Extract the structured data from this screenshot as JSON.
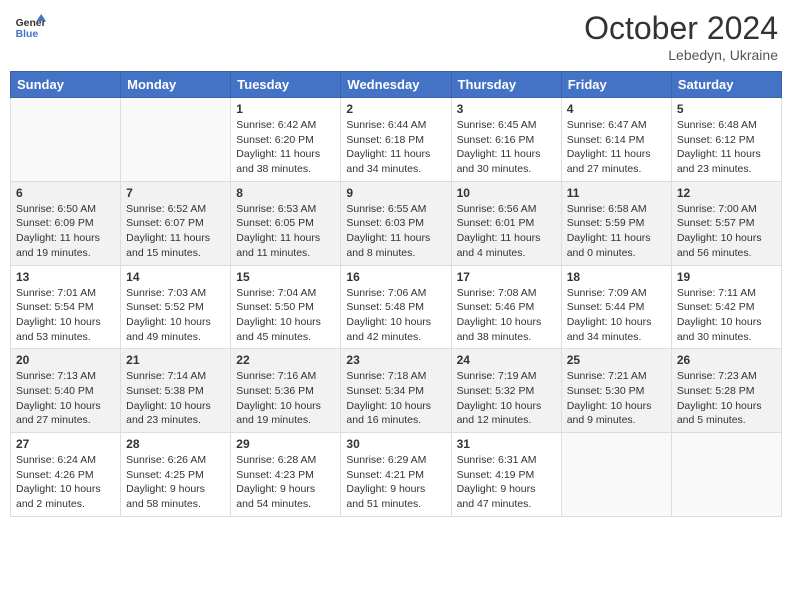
{
  "header": {
    "logo_line1": "General",
    "logo_line2": "Blue",
    "month": "October 2024",
    "location": "Lebedyn, Ukraine"
  },
  "weekdays": [
    "Sunday",
    "Monday",
    "Tuesday",
    "Wednesday",
    "Thursday",
    "Friday",
    "Saturday"
  ],
  "weeks": [
    [
      {
        "day": "",
        "info": ""
      },
      {
        "day": "",
        "info": ""
      },
      {
        "day": "1",
        "info": "Sunrise: 6:42 AM\nSunset: 6:20 PM\nDaylight: 11 hours and 38 minutes."
      },
      {
        "day": "2",
        "info": "Sunrise: 6:44 AM\nSunset: 6:18 PM\nDaylight: 11 hours and 34 minutes."
      },
      {
        "day": "3",
        "info": "Sunrise: 6:45 AM\nSunset: 6:16 PM\nDaylight: 11 hours and 30 minutes."
      },
      {
        "day": "4",
        "info": "Sunrise: 6:47 AM\nSunset: 6:14 PM\nDaylight: 11 hours and 27 minutes."
      },
      {
        "day": "5",
        "info": "Sunrise: 6:48 AM\nSunset: 6:12 PM\nDaylight: 11 hours and 23 minutes."
      }
    ],
    [
      {
        "day": "6",
        "info": "Sunrise: 6:50 AM\nSunset: 6:09 PM\nDaylight: 11 hours and 19 minutes."
      },
      {
        "day": "7",
        "info": "Sunrise: 6:52 AM\nSunset: 6:07 PM\nDaylight: 11 hours and 15 minutes."
      },
      {
        "day": "8",
        "info": "Sunrise: 6:53 AM\nSunset: 6:05 PM\nDaylight: 11 hours and 11 minutes."
      },
      {
        "day": "9",
        "info": "Sunrise: 6:55 AM\nSunset: 6:03 PM\nDaylight: 11 hours and 8 minutes."
      },
      {
        "day": "10",
        "info": "Sunrise: 6:56 AM\nSunset: 6:01 PM\nDaylight: 11 hours and 4 minutes."
      },
      {
        "day": "11",
        "info": "Sunrise: 6:58 AM\nSunset: 5:59 PM\nDaylight: 11 hours and 0 minutes."
      },
      {
        "day": "12",
        "info": "Sunrise: 7:00 AM\nSunset: 5:57 PM\nDaylight: 10 hours and 56 minutes."
      }
    ],
    [
      {
        "day": "13",
        "info": "Sunrise: 7:01 AM\nSunset: 5:54 PM\nDaylight: 10 hours and 53 minutes."
      },
      {
        "day": "14",
        "info": "Sunrise: 7:03 AM\nSunset: 5:52 PM\nDaylight: 10 hours and 49 minutes."
      },
      {
        "day": "15",
        "info": "Sunrise: 7:04 AM\nSunset: 5:50 PM\nDaylight: 10 hours and 45 minutes."
      },
      {
        "day": "16",
        "info": "Sunrise: 7:06 AM\nSunset: 5:48 PM\nDaylight: 10 hours and 42 minutes."
      },
      {
        "day": "17",
        "info": "Sunrise: 7:08 AM\nSunset: 5:46 PM\nDaylight: 10 hours and 38 minutes."
      },
      {
        "day": "18",
        "info": "Sunrise: 7:09 AM\nSunset: 5:44 PM\nDaylight: 10 hours and 34 minutes."
      },
      {
        "day": "19",
        "info": "Sunrise: 7:11 AM\nSunset: 5:42 PM\nDaylight: 10 hours and 30 minutes."
      }
    ],
    [
      {
        "day": "20",
        "info": "Sunrise: 7:13 AM\nSunset: 5:40 PM\nDaylight: 10 hours and 27 minutes."
      },
      {
        "day": "21",
        "info": "Sunrise: 7:14 AM\nSunset: 5:38 PM\nDaylight: 10 hours and 23 minutes."
      },
      {
        "day": "22",
        "info": "Sunrise: 7:16 AM\nSunset: 5:36 PM\nDaylight: 10 hours and 19 minutes."
      },
      {
        "day": "23",
        "info": "Sunrise: 7:18 AM\nSunset: 5:34 PM\nDaylight: 10 hours and 16 minutes."
      },
      {
        "day": "24",
        "info": "Sunrise: 7:19 AM\nSunset: 5:32 PM\nDaylight: 10 hours and 12 minutes."
      },
      {
        "day": "25",
        "info": "Sunrise: 7:21 AM\nSunset: 5:30 PM\nDaylight: 10 hours and 9 minutes."
      },
      {
        "day": "26",
        "info": "Sunrise: 7:23 AM\nSunset: 5:28 PM\nDaylight: 10 hours and 5 minutes."
      }
    ],
    [
      {
        "day": "27",
        "info": "Sunrise: 6:24 AM\nSunset: 4:26 PM\nDaylight: 10 hours and 2 minutes."
      },
      {
        "day": "28",
        "info": "Sunrise: 6:26 AM\nSunset: 4:25 PM\nDaylight: 9 hours and 58 minutes."
      },
      {
        "day": "29",
        "info": "Sunrise: 6:28 AM\nSunset: 4:23 PM\nDaylight: 9 hours and 54 minutes."
      },
      {
        "day": "30",
        "info": "Sunrise: 6:29 AM\nSunset: 4:21 PM\nDaylight: 9 hours and 51 minutes."
      },
      {
        "day": "31",
        "info": "Sunrise: 6:31 AM\nSunset: 4:19 PM\nDaylight: 9 hours and 47 minutes."
      },
      {
        "day": "",
        "info": ""
      },
      {
        "day": "",
        "info": ""
      }
    ]
  ]
}
